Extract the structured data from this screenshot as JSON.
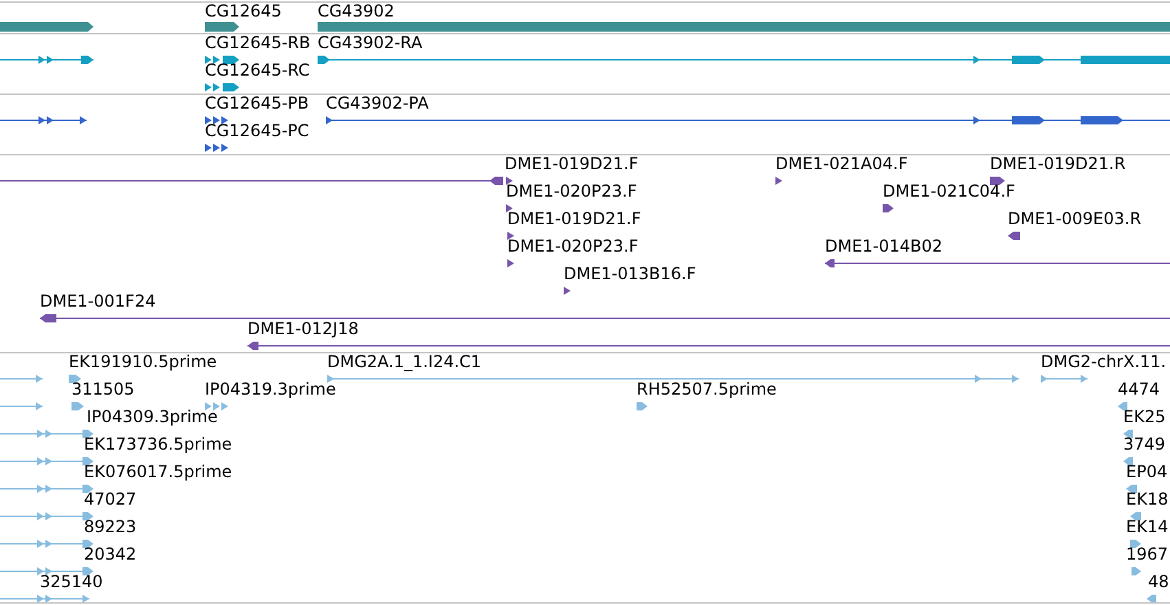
{
  "tracks": [
    {
      "kind": "gene",
      "color": "#3f9092",
      "features": [
        {
          "reverse": false
        },
        {
          "label": "CG12645",
          "reverse": false
        },
        {
          "label": "CG43902"
        }
      ]
    },
    {
      "kind": "transcript",
      "color": "#14a0c2",
      "features": [
        {
          "reverse": false
        },
        {
          "label": "CG12645-RB",
          "reverse": false
        },
        {
          "label": "CG12645-RC",
          "reverse": false
        },
        {
          "label": "CG43902-RA",
          "reverse": false
        }
      ]
    },
    {
      "kind": "cds",
      "color": "#3366cc",
      "features": [
        {
          "reverse": false
        },
        {
          "label": "CG12645-PB",
          "reverse": false
        },
        {
          "label": "CG12645-PC",
          "reverse": false
        },
        {
          "label": "CG43902-PA",
          "reverse": false
        }
      ]
    },
    {
      "kind": "clone",
      "color": "#7755aa",
      "features": [
        {
          "reverse": true
        },
        {
          "label": "DME1-019D21.F",
          "reverse": false
        },
        {
          "label": "DME1-021A04.F",
          "reverse": false
        },
        {
          "label": "DME1-019D21.R",
          "reverse": false
        },
        {
          "label": "DME1-020P23.F",
          "reverse": false
        },
        {
          "label": "DME1-021C04.F",
          "reverse": false
        },
        {
          "label": "DME1-019D21.F",
          "reverse": false
        },
        {
          "label": "DME1-009E03.R",
          "reverse": true
        },
        {
          "label": "DME1-020P23.F",
          "reverse": false
        },
        {
          "label": "DME1-014B02",
          "reverse": true
        },
        {
          "label": "DME1-013B16.F",
          "reverse": false
        },
        {
          "label": "DME1-001F24",
          "reverse": true
        },
        {
          "label": "DME1-012J18",
          "reverse": true
        }
      ]
    },
    {
      "kind": "est",
      "color": "#88bde0",
      "features": [
        {
          "reverse": false
        },
        {
          "label": "EK191910.5prime",
          "reverse": false
        },
        {
          "label": "DMG2A.1_1.I24.C1",
          "reverse": false
        },
        {
          "label": "DMG2-chrX.11.",
          "reverse": false
        },
        {
          "reverse": false
        },
        {
          "label": "311505",
          "reverse": false
        },
        {
          "label": "IP04319.3prime",
          "reverse": false
        },
        {
          "label": "RH52507.5prime",
          "reverse": false
        },
        {
          "label": "4474",
          "reverse": true
        },
        {
          "reverse": false
        },
        {
          "label": "IP04309.3prime",
          "reverse": false
        },
        {
          "label": "EK25",
          "reverse": true
        },
        {
          "reverse": false
        },
        {
          "label": "EK173736.5prime",
          "reverse": false
        },
        {
          "label": "3749",
          "reverse": true
        },
        {
          "reverse": false
        },
        {
          "label": "EK076017.5prime",
          "reverse": false
        },
        {
          "label": "EP04",
          "reverse": true
        },
        {
          "reverse": false
        },
        {
          "label": "47027",
          "reverse": false
        },
        {
          "label": "EK18",
          "reverse": true
        },
        {
          "reverse": false
        },
        {
          "label": "89223",
          "reverse": false
        },
        {
          "label": "EK14",
          "reverse": false
        },
        {
          "reverse": false
        },
        {
          "label": "20342",
          "reverse": false
        },
        {
          "label": "1967",
          "reverse": false
        },
        {
          "label": "325140",
          "reverse": false
        },
        {
          "label": "48",
          "reverse": true
        }
      ]
    }
  ]
}
